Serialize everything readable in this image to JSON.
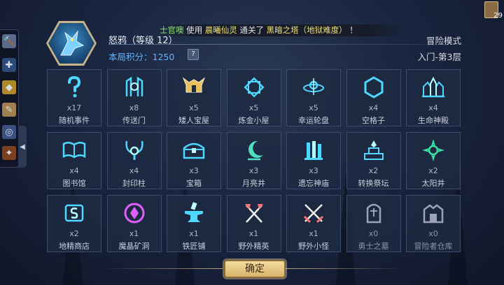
{
  "notice": {
    "player": "士官噢",
    "t1": " 使用 ",
    "hero": "晨曦仙灵",
    "t2": " 通关了 ",
    "place": "黑暗之塔（地狱难度）",
    "t3": " ！"
  },
  "player": {
    "name": "怒鸦（等级 12）",
    "score_label": "本局积分：",
    "score": "1250",
    "help": "?"
  },
  "mode": "冒险模式",
  "floor": "入门-第3层",
  "card_count": "29",
  "tiles": [
    {
      "count": "x17",
      "label": "随机事件",
      "icon": "question-icon"
    },
    {
      "count": "x8",
      "label": "传送门",
      "icon": "portal-icon"
    },
    {
      "count": "x5",
      "label": "矮人宝屋",
      "icon": "dwarf-helmet-icon"
    },
    {
      "count": "x5",
      "label": "炼金小屋",
      "icon": "alchemy-icon"
    },
    {
      "count": "x5",
      "label": "幸运轮盘",
      "icon": "roulette-icon"
    },
    {
      "count": "x4",
      "label": "空格子",
      "icon": "empty-hex-icon"
    },
    {
      "count": "x4",
      "label": "生命神殿",
      "icon": "temple-icon"
    },
    {
      "count": "x4",
      "label": "图书馆",
      "icon": "book-icon"
    },
    {
      "count": "x4",
      "label": "封印柱",
      "icon": "seal-pillar-icon"
    },
    {
      "count": "x3",
      "label": "宝箱",
      "icon": "chest-icon"
    },
    {
      "count": "x3",
      "label": "月亮井",
      "icon": "moon-icon"
    },
    {
      "count": "x3",
      "label": "遗忘神庙",
      "icon": "ruins-icon"
    },
    {
      "count": "x2",
      "label": "转换祭坛",
      "icon": "altar-icon"
    },
    {
      "count": "x2",
      "label": "太阳井",
      "icon": "sun-icon"
    },
    {
      "count": "x2",
      "label": "地精商店",
      "icon": "shop-icon"
    },
    {
      "count": "x1",
      "label": "魔晶矿洞",
      "icon": "crystal-icon"
    },
    {
      "count": "x1",
      "label": "铁匠铺",
      "icon": "anvil-icon"
    },
    {
      "count": "x1",
      "label": "野外精英",
      "icon": "elite-axes-icon"
    },
    {
      "count": "x1",
      "label": "野外小怪",
      "icon": "swords-icon"
    },
    {
      "count": "x0",
      "label": "勇士之墓",
      "icon": "tomb-icon"
    },
    {
      "count": "x0",
      "label": "冒险者仓库",
      "icon": "warehouse-icon"
    }
  ],
  "confirm_label": "确定",
  "colors": {
    "accent": "#4fd8ff",
    "elite": "#ff7070",
    "crystal": "#e060ff",
    "gold": "#e8c060"
  }
}
